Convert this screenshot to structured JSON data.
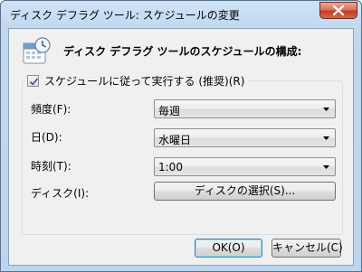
{
  "window": {
    "title": "ディスク デフラグ ツール: スケジュールの変更"
  },
  "header": {
    "text": "ディスク デフラグ ツールのスケジュールの構成:",
    "icon": "calendar-clock-icon"
  },
  "schedule_checkbox": {
    "label": "スケジュールに従って実行する (推奨)(R)",
    "checked": true
  },
  "fields": {
    "frequency": {
      "label": "頻度(F):",
      "value": "毎週"
    },
    "day": {
      "label": "日(D):",
      "value": "水曜日"
    },
    "time": {
      "label": "時刻(T):",
      "value": "1:00"
    },
    "disk": {
      "label": "ディスク(I):",
      "button": "ディスクの選択(S)..."
    }
  },
  "buttons": {
    "ok": "OK(O)",
    "cancel": "キャンセル(C)"
  }
}
